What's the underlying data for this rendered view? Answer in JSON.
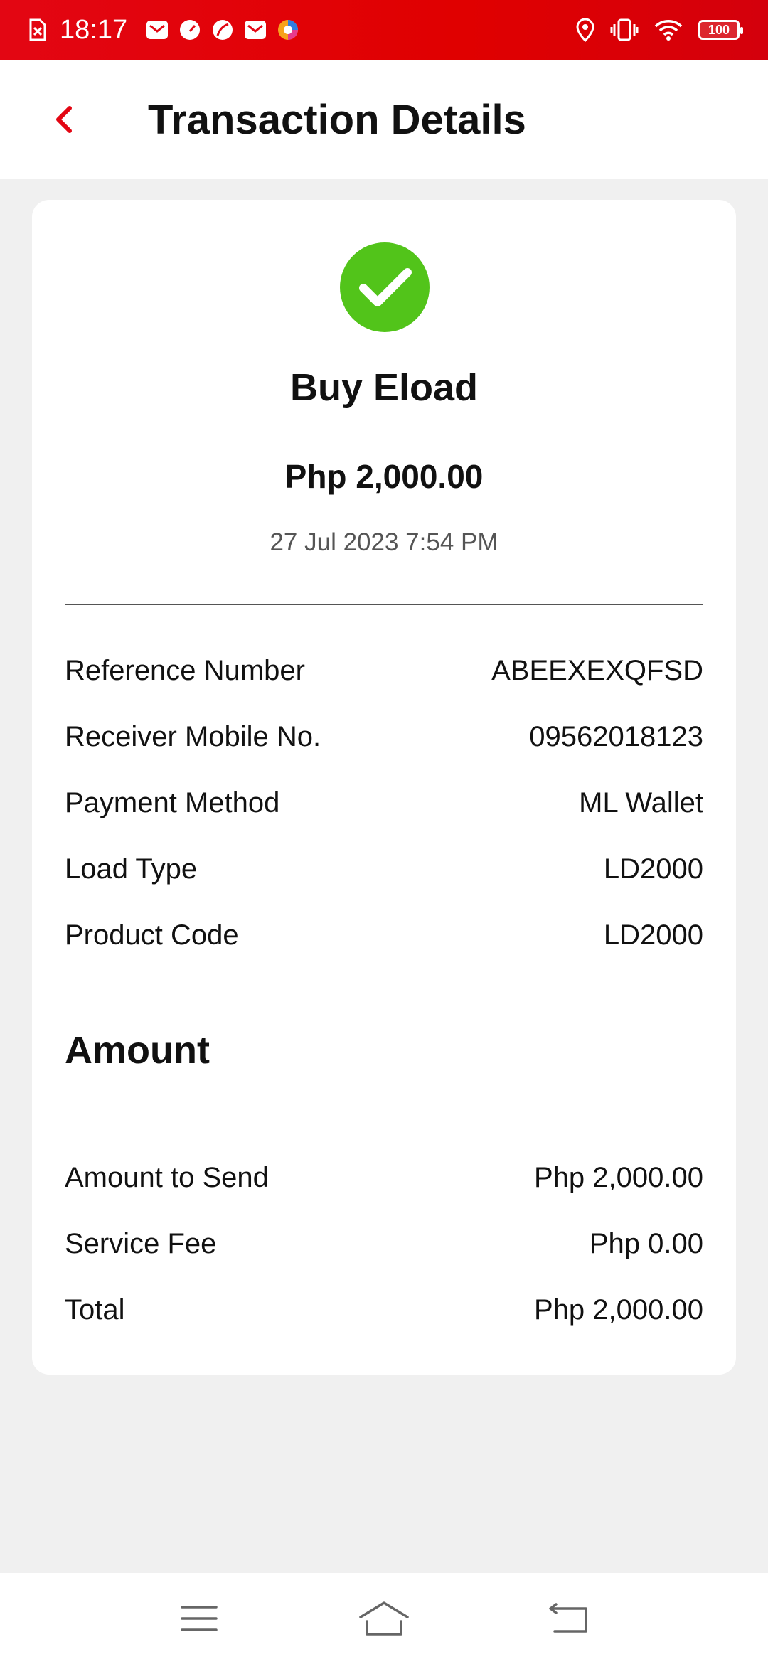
{
  "status_bar": {
    "time": "18:17",
    "battery": "100",
    "icons": [
      "sim-error-icon",
      "mail-icon",
      "speed-icon",
      "leaf-icon",
      "mail-icon",
      "browser-icon",
      "location-icon",
      "vibrate-icon",
      "wifi-icon",
      "battery-icon"
    ]
  },
  "header": {
    "title": "Transaction Details",
    "back_icon": "chevron-left-icon"
  },
  "transaction": {
    "status_icon": "check-circle-icon",
    "type": "Buy Eload",
    "amount": "Php 2,000.00",
    "date": "27 Jul 2023 7:54 PM"
  },
  "details": [
    {
      "label": "Reference Number",
      "value": "ABEEXEXQFSD"
    },
    {
      "label": "Receiver Mobile No.",
      "value": "09562018123"
    },
    {
      "label": "Payment Method",
      "value": "ML Wallet"
    },
    {
      "label": "Load Type",
      "value": "LD2000"
    },
    {
      "label": "Product Code",
      "value": "LD2000"
    }
  ],
  "amount_section": {
    "heading": "Amount",
    "rows": [
      {
        "label": "Amount to Send",
        "value": "Php 2,000.00"
      },
      {
        "label": "Service Fee",
        "value": "Php 0.00"
      },
      {
        "label": "Total",
        "value": "Php 2,000.00"
      }
    ]
  },
  "colors": {
    "brand_red": "#e30613",
    "success_green": "#52c41a"
  },
  "nav_bar": {
    "icons": [
      "menu-icon",
      "home-icon",
      "back-icon"
    ]
  }
}
